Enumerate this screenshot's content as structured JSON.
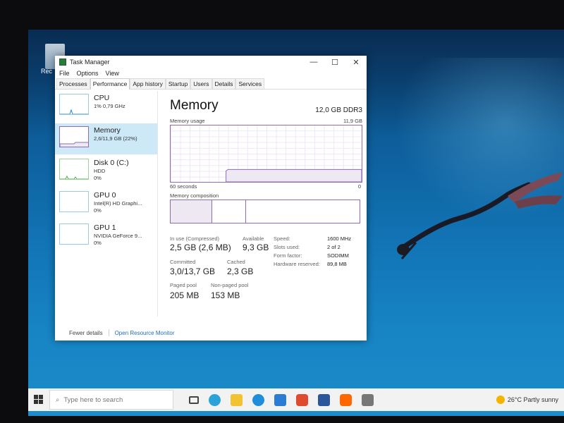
{
  "desktop": {
    "icon_label": "Rec"
  },
  "window": {
    "title": "Task Manager",
    "controls": {
      "minimize": "—",
      "maximize": "☐",
      "close": "✕"
    },
    "menu": [
      "File",
      "Options",
      "View"
    ],
    "tabs": [
      "Processes",
      "Performance",
      "App history",
      "Startup",
      "Users",
      "Details",
      "Services"
    ],
    "active_tab": "Performance"
  },
  "sidebar": {
    "items": [
      {
        "name": "CPU",
        "sub1": "1% 0,79 GHz",
        "sub2": ""
      },
      {
        "name": "Memory",
        "sub1": "2,6/11,9 GB (22%)",
        "sub2": ""
      },
      {
        "name": "Disk 0 (C:)",
        "sub1": "HDD",
        "sub2": "0%"
      },
      {
        "name": "GPU 0",
        "sub1": "Intel(R) HD Graphi...",
        "sub2": "0%"
      },
      {
        "name": "GPU 1",
        "sub1": "NVIDIA GeForce 9...",
        "sub2": "0%"
      }
    ],
    "selected": "Memory"
  },
  "main": {
    "title": "Memory",
    "capacity": "12,0 GB DDR3",
    "usage_label": "Memory usage",
    "usage_max": "11,9 GB",
    "time_label": "60 seconds",
    "time_zero": "0",
    "composition_label": "Memory composition",
    "in_use_fraction": 0.22,
    "stats": {
      "in_use_label": "In use (Compressed)",
      "in_use": "2,5 GB (2,6 MB)",
      "available_label": "Available",
      "available": "9,3 GB",
      "committed_label": "Committed",
      "committed": "3,0/13,7 GB",
      "cached_label": "Cached",
      "cached": "2,3 GB",
      "paged_label": "Paged pool",
      "paged": "205 MB",
      "nonpaged_label": "Non-paged pool",
      "nonpaged": "153 MB"
    },
    "details": {
      "speed_label": "Speed:",
      "speed": "1600 MHz",
      "slots_label": "Slots used:",
      "slots": "2 of 2",
      "form_label": "Form factor:",
      "form": "SODIMM",
      "reserved_label": "Hardware reserved:",
      "reserved": "89,8 MB"
    }
  },
  "footer": {
    "fewer": "Fewer details",
    "monitor": "Open Resource Monitor"
  },
  "taskbar": {
    "search_placeholder": "Type here to search",
    "weather": "26°C  Partly sunny"
  },
  "colors": {
    "memory_accent": "#8e6bb5",
    "selected_bg": "#cde8f7",
    "desktop": "#1274b5"
  }
}
